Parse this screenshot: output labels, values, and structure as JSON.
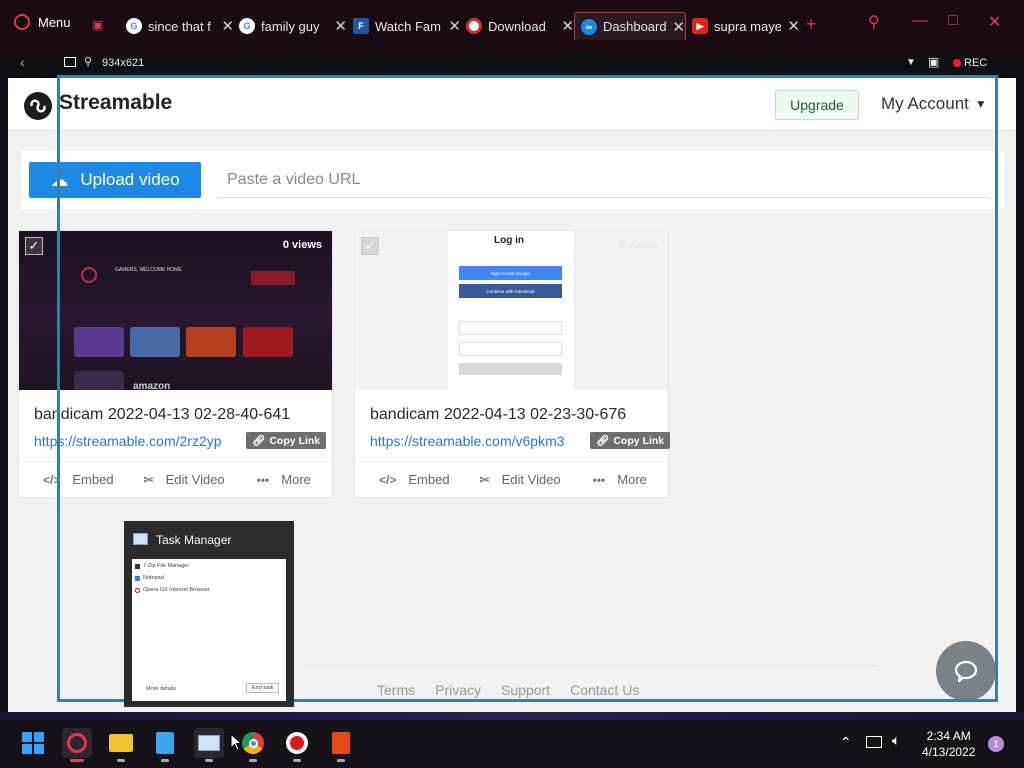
{
  "browser": {
    "menu_label": "Menu",
    "tabs": [
      {
        "label": "since that f",
        "icon": "google-icon"
      },
      {
        "label": "family guy",
        "icon": "google-icon"
      },
      {
        "label": "Watch Fam",
        "icon": "fox-icon"
      },
      {
        "label": "Download",
        "icon": "record-icon"
      },
      {
        "label": "Dashboard",
        "icon": "streamable-icon",
        "active": true
      },
      {
        "label": "supra maye",
        "icon": "youtube-icon"
      }
    ],
    "capture_size": "934x621",
    "rec_label": "REC"
  },
  "streamable": {
    "logo_text": "Streamable",
    "upgrade_label": "Upgrade",
    "account_label": "My Account",
    "upload_label": "Upload video",
    "url_placeholder": "Paste a video URL",
    "videos": [
      {
        "title": "bandicam 2022-04-13 02-28-40-641",
        "link": "https://streamable.com/2rz2yp",
        "views": "0 views",
        "copy_label": "Copy Link",
        "embed_label": "Embed",
        "edit_label": "Edit Video",
        "more_label": "More"
      },
      {
        "title": "bandicam 2022-04-13 02-23-30-676",
        "link": "https://streamable.com/v6pkm3",
        "views": "0 views",
        "copy_label": "Copy Link",
        "embed_label": "Embed",
        "edit_label": "Edit Video",
        "more_label": "More"
      }
    ],
    "thumb1": {
      "heading": "GAMERS, WELCOME HOME",
      "brand": "amazon"
    },
    "thumb2": {
      "login_title": "Log in",
      "google_btn": "Sign in with Google",
      "facebook_btn": "Continue with Facebook"
    },
    "footer": [
      "Terms",
      "Privacy",
      "Support",
      "Contact Us"
    ]
  },
  "task_manager_preview": {
    "title": "Task Manager",
    "items": [
      "7-Zip File Manager",
      "Notepad",
      "Opera GX Internet Browser"
    ],
    "more_details": "More details",
    "end_task": "End task"
  },
  "taskbar": {
    "time": "2:34 AM",
    "date": "4/13/2022",
    "notifications": "1"
  },
  "colors": {
    "accent_blue": "#1e88e5",
    "opera_red": "#e23a4a",
    "capture_frame": "#3a7ea6"
  }
}
